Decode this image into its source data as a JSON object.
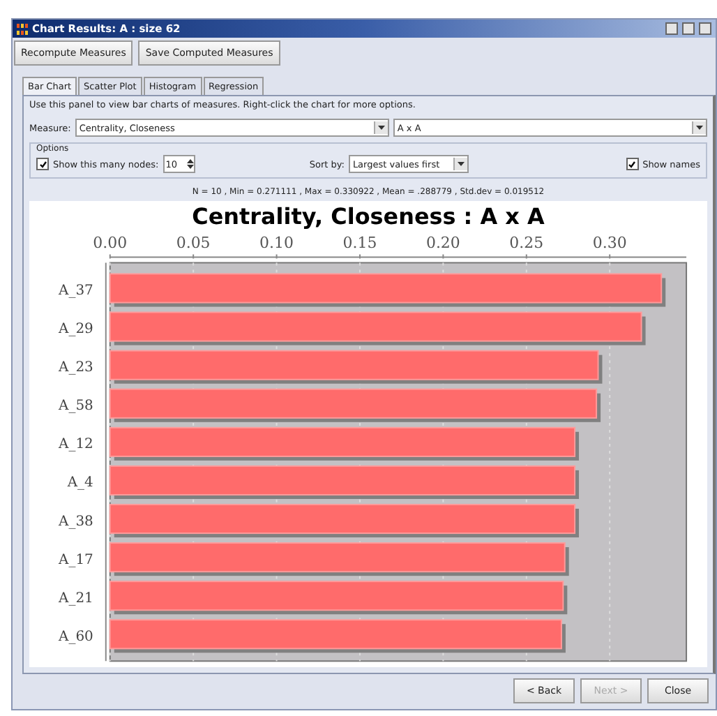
{
  "window": {
    "title": "Chart Results: A : size 62"
  },
  "toolbar": [
    "Recompute Measures",
    "Save Computed Measures"
  ],
  "tabs": [
    {
      "label": "Bar Chart",
      "selected": true
    },
    {
      "label": "Scatter Plot",
      "selected": false
    },
    {
      "label": "Histogram",
      "selected": false
    },
    {
      "label": "Regression",
      "selected": false
    }
  ],
  "hint": "Use this panel to view bar charts of measures. Right-click the chart for more options.",
  "measure": {
    "label": "Measure:",
    "value": "Centrality, Closeness",
    "matrix": "A x A"
  },
  "options": {
    "title": "Options",
    "show_nodes": {
      "label": "Show this many nodes:",
      "checked": true,
      "value": "10"
    },
    "sort": {
      "label": "Sort by:",
      "value": "Largest values first"
    },
    "show_names": {
      "label": "Show names",
      "checked": true
    }
  },
  "stats": "N = 10 , Min = 0.271111 , Max = 0.330922 , Mean = .288779 , Std.dev = 0.019512",
  "chart_data": {
    "type": "bar",
    "orientation": "horizontal",
    "title": "Centrality, Closeness : A x A",
    "categories": [
      "A_37",
      "A_29",
      "A_23",
      "A_58",
      "A_12",
      "A_4",
      "A_38",
      "A_17",
      "A_21",
      "A_60"
    ],
    "values": [
      0.331,
      0.319,
      0.293,
      0.292,
      0.279,
      0.279,
      0.279,
      0.273,
      0.272,
      0.271
    ],
    "grid": true,
    "xlim": [
      0,
      0.346
    ],
    "xticks": [
      {
        "value": 0,
        "label": "0.00"
      },
      {
        "value": 0.05,
        "label": "0.05"
      },
      {
        "value": 0.1,
        "label": "0.10"
      },
      {
        "value": 0.15,
        "label": "0.15"
      },
      {
        "value": 0.2,
        "label": "0.20"
      },
      {
        "value": 0.25,
        "label": "0.25"
      },
      {
        "value": 0.3,
        "label": "0.30"
      }
    ]
  },
  "footer": [
    {
      "label": "< Back",
      "disabled": false
    },
    {
      "label": "Next >",
      "disabled": true
    },
    {
      "label": "Close",
      "disabled": false
    }
  ]
}
